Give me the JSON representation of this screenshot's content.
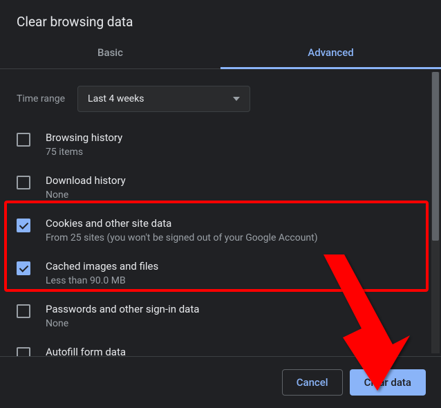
{
  "title": "Clear browsing data",
  "tabs": {
    "basic": "Basic",
    "advanced": "Advanced"
  },
  "timeRange": {
    "label": "Time range",
    "value": "Last 4 weeks"
  },
  "options": [
    {
      "title": "Browsing history",
      "sub": "75 items",
      "checked": false
    },
    {
      "title": "Download history",
      "sub": "None",
      "checked": false
    },
    {
      "title": "Cookies and other site data",
      "sub": "From 25 sites (you won't be signed out of your Google Account)",
      "checked": true
    },
    {
      "title": "Cached images and files",
      "sub": "Less than 90.0 MB",
      "checked": true
    },
    {
      "title": "Passwords and other sign-in data",
      "sub": "None",
      "checked": false
    },
    {
      "title": "Autofill form data",
      "sub": "",
      "checked": false
    }
  ],
  "buttons": {
    "cancel": "Cancel",
    "clear": "Clear data"
  },
  "colors": {
    "accent": "#8ab4f8",
    "highlight": "#ff0000"
  }
}
